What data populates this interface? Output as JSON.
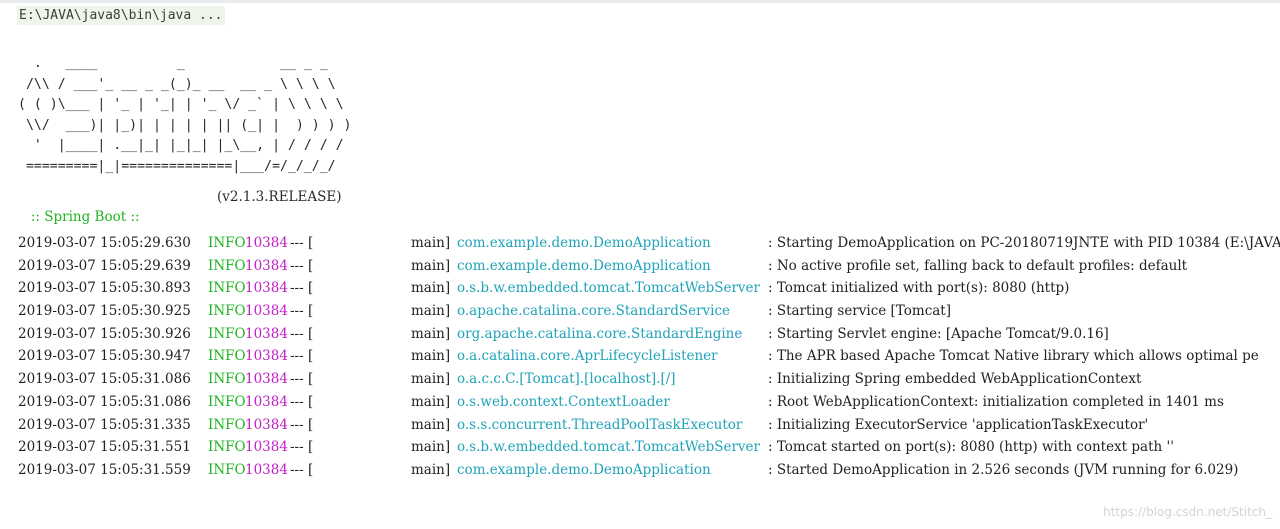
{
  "console": {
    "command": "E:\\JAVA\\java8\\bin\\java ...",
    "banner": [
      "  .   ____          _            __ _ _",
      " /\\\\ / ___'_ __ _ _(_)_ __  __ _ \\ \\ \\ \\",
      "( ( )\\___ | '_ | '_| | '_ \\/ _` | \\ \\ \\ \\",
      " \\\\/  ___)| |_)| | | | | || (_| |  ) ) ) )",
      "  '  |____| .__|_| |_|_| |_\\__, | / / / /",
      " =========|_|==============|___/=/_/_/_/"
    ],
    "boot_label": " :: Spring Boot :: ",
    "boot_version": "(v2.1.3.RELEASE)",
    "colors": {
      "level": "#1fb41f",
      "pid": "#c21dc9",
      "logger": "#1fa3b8"
    },
    "log": [
      {
        "ts": "2019-03-07 15:05:29.630",
        "level": "INFO",
        "pid": "10384",
        "sep": "--- [",
        "thread": "main]",
        "logger": "com.example.demo.DemoApplication",
        "msg": ": Starting DemoApplication on PC-20180719JNTE with PID 10384 (E:\\JAVA"
      },
      {
        "ts": "2019-03-07 15:05:29.639",
        "level": "INFO",
        "pid": "10384",
        "sep": "--- [",
        "thread": "main]",
        "logger": "com.example.demo.DemoApplication",
        "msg": ": No active profile set, falling back to default profiles: default"
      },
      {
        "ts": "2019-03-07 15:05:30.893",
        "level": "INFO",
        "pid": "10384",
        "sep": "--- [",
        "thread": "main]",
        "logger": "o.s.b.w.embedded.tomcat.TomcatWebServer",
        "msg": ": Tomcat initialized with port(s): 8080 (http)"
      },
      {
        "ts": "2019-03-07 15:05:30.925",
        "level": "INFO",
        "pid": "10384",
        "sep": "--- [",
        "thread": "main]",
        "logger": "o.apache.catalina.core.StandardService",
        "msg": ": Starting service [Tomcat]"
      },
      {
        "ts": "2019-03-07 15:05:30.926",
        "level": "INFO",
        "pid": "10384",
        "sep": "--- [",
        "thread": "main]",
        "logger": "org.apache.catalina.core.StandardEngine",
        "msg": ": Starting Servlet engine: [Apache Tomcat/9.0.16]"
      },
      {
        "ts": "2019-03-07 15:05:30.947",
        "level": "INFO",
        "pid": "10384",
        "sep": "--- [",
        "thread": "main]",
        "logger": "o.a.catalina.core.AprLifecycleListener",
        "msg": ": The APR based Apache Tomcat Native library which allows optimal pe"
      },
      {
        "ts": "2019-03-07 15:05:31.086",
        "level": "INFO",
        "pid": "10384",
        "sep": "--- [",
        "thread": "main]",
        "logger": "o.a.c.c.C.[Tomcat].[localhost].[/]",
        "msg": ": Initializing Spring embedded WebApplicationContext"
      },
      {
        "ts": "2019-03-07 15:05:31.086",
        "level": "INFO",
        "pid": "10384",
        "sep": "--- [",
        "thread": "main]",
        "logger": "o.s.web.context.ContextLoader",
        "msg": ": Root WebApplicationContext: initialization completed in 1401 ms"
      },
      {
        "ts": "2019-03-07 15:05:31.335",
        "level": "INFO",
        "pid": "10384",
        "sep": "--- [",
        "thread": "main]",
        "logger": "o.s.s.concurrent.ThreadPoolTaskExecutor",
        "msg": ": Initializing ExecutorService 'applicationTaskExecutor'"
      },
      {
        "ts": "2019-03-07 15:05:31.551",
        "level": "INFO",
        "pid": "10384",
        "sep": "--- [",
        "thread": "main]",
        "logger": "o.s.b.w.embedded.tomcat.TomcatWebServer",
        "msg": ": Tomcat started on port(s): 8080 (http) with context path ''"
      },
      {
        "ts": "2019-03-07 15:05:31.559",
        "level": "INFO",
        "pid": "10384",
        "sep": "--- [",
        "thread": "main]",
        "logger": "com.example.demo.DemoApplication",
        "msg": ": Started DemoApplication in 2.526 seconds (JVM running for 6.029)"
      }
    ]
  },
  "watermark": "https://blog.csdn.net/Stitch_"
}
